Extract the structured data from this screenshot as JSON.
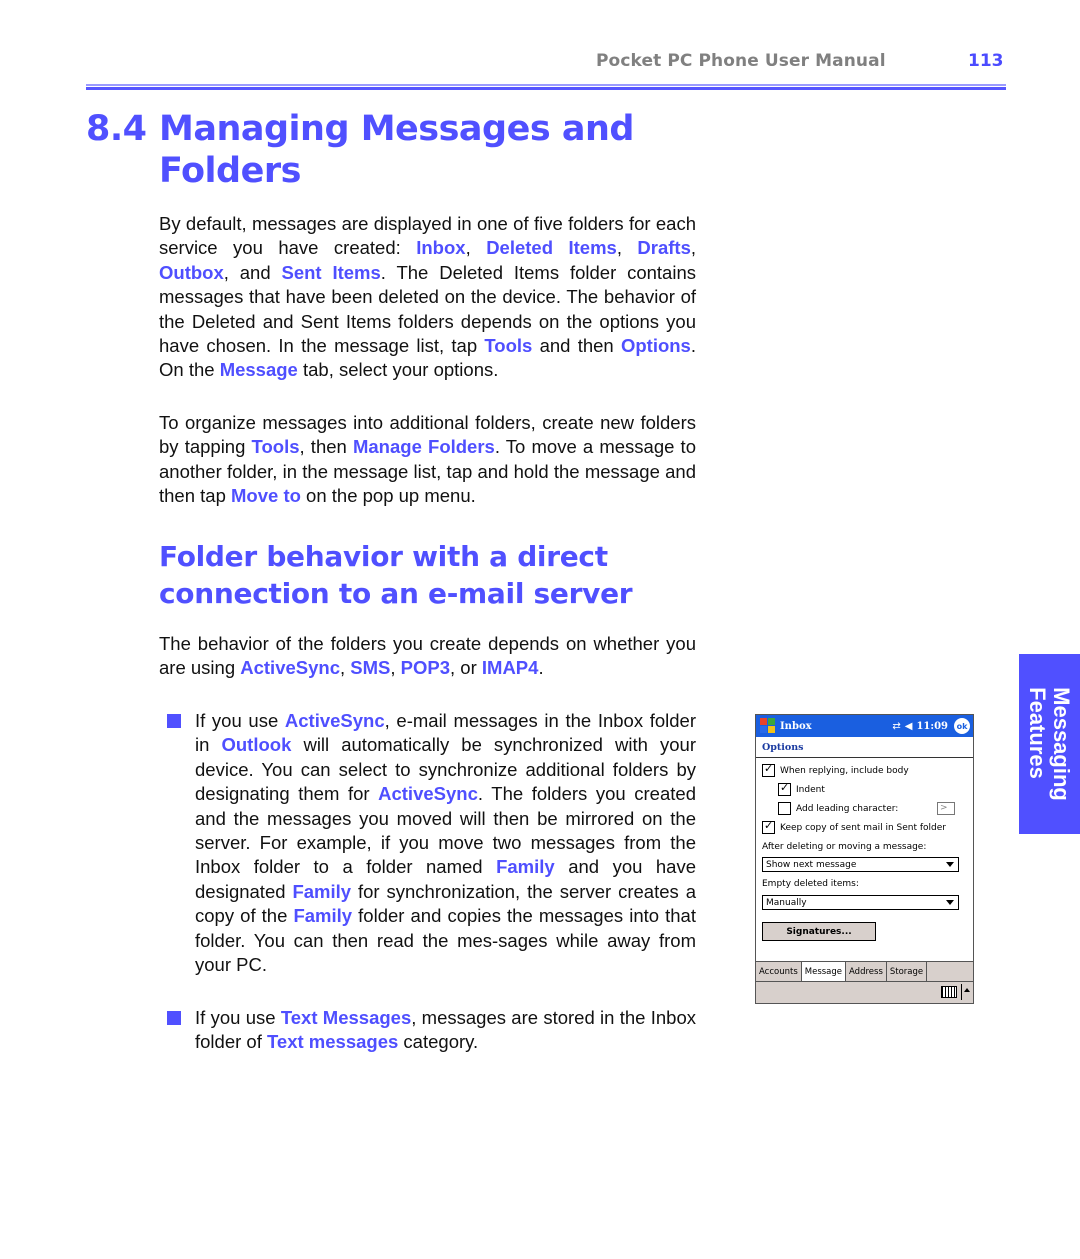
{
  "header": {
    "manual_title": "Pocket PC Phone User Manual",
    "page_number": "113"
  },
  "section": {
    "number": "8.4",
    "title_line1": "Managing Messages and",
    "title_line2": "Folders"
  },
  "paragraph1": {
    "t1": "By default, messages are displayed in one of five folders for each service you have created: ",
    "inbox": "Inbox",
    "c1": ", ",
    "deleted_items": "Deleted Items",
    "c2": ", ",
    "drafts": "Drafts",
    "c3": ", ",
    "outbox": "Outbox",
    "t2": ", and ",
    "sent_items": "Sent Items",
    "t3": ". The Deleted Items folder contains messages that have been deleted on the device. The behavior of the Deleted and Sent Items folders depends on the options you have chosen. In the message list, tap ",
    "tools": "Tools",
    "t4": " and then ",
    "options": "Options",
    "t5": ". On the ",
    "message": "Message",
    "t6": " tab, select your options."
  },
  "paragraph2": {
    "t1": "To organize messages into additional folders, create new folders by tapping ",
    "tools": "Tools",
    "t2": ", then ",
    "manage_folders": "Manage Folders",
    "t3": ". To move a message to another folder, in the message list, tap and hold the message and then tap ",
    "move_to": "Move to",
    "t4": " on the pop up menu."
  },
  "subheading": {
    "line1": "Folder behavior with a direct",
    "line2": "connection to an e-mail server"
  },
  "paragraph3": {
    "t1": "The behavior of the folders you create depends on whether you are using ",
    "activesync": "ActiveSync",
    "c1": ", ",
    "sms": "SMS",
    "c2": ", ",
    "pop3": "POP3",
    "t2": ", or ",
    "imap4": "IMAP4",
    "t3": "."
  },
  "bullet1": {
    "t1": "If you use ",
    "activesync": "ActiveSync",
    "t2": ", e-mail messages in the Inbox folder in ",
    "outlook": "Outlook",
    "t3": " will automatically be synchronized with your device. You can select to synchronize additional folders by designating them for ",
    "activesync2": "ActiveSync",
    "t4": ". The folders you created and the messages you moved will then be mirrored on the server. For example, if you move two messages from the Inbox folder to a folder named ",
    "family1": "Family",
    "t5": " and you have designated ",
    "family2": "Family",
    "t6": " for synchronization, the server creates a copy of the ",
    "family3": "Family",
    "t7": " folder and copies the messages into that folder. You can then read the mes-sages while away from your PC."
  },
  "bullet2": {
    "t1": "If you use ",
    "text_messages": "Text Messages",
    "t2": ", messages are stored in the Inbox folder of ",
    "text_messages2": "Text messages",
    "t3": " category."
  },
  "device_screen": {
    "app_title": "Inbox",
    "time": "11:09",
    "ok_label": "ok",
    "connectivity_icon": "⇄",
    "speaker_icon": "◀",
    "subtitle": "Options",
    "options": [
      {
        "label": "When replying, include body",
        "checked": true
      },
      {
        "label": "Indent",
        "checked": true
      },
      {
        "label": "Add leading character:",
        "checked": false,
        "value": ">"
      },
      {
        "label": "Keep copy of sent mail in Sent folder",
        "checked": true
      }
    ],
    "after_delete_label": "After deleting or moving a message:",
    "after_delete_value": "Show next message",
    "empty_deleted_label": "Empty deleted items:",
    "empty_deleted_value": "Manually",
    "signatures_button": "Signatures...",
    "tabs": [
      {
        "label": "Accounts",
        "active": false
      },
      {
        "label": "Message",
        "active": true
      },
      {
        "label": "Address",
        "active": false
      },
      {
        "label": "Storage",
        "active": false
      }
    ]
  },
  "side_tab": {
    "line1": "Messaging",
    "line2": "Features"
  },
  "colors": {
    "accent": "#5050ff",
    "header_gray": "#808080",
    "device_titlebar": "#1a5fe0"
  }
}
